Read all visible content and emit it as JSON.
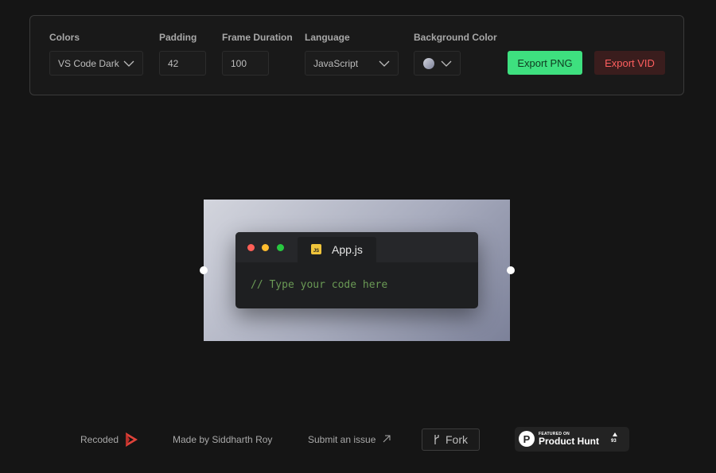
{
  "toolbar": {
    "colors": {
      "label": "Colors",
      "value": "VS Code Dark"
    },
    "padding": {
      "label": "Padding",
      "value": "42"
    },
    "frame_duration": {
      "label": "Frame Duration",
      "value": "100"
    },
    "language": {
      "label": "Language",
      "value": "JavaScript"
    },
    "background_color": {
      "label": "Background Color",
      "swatch_color": "#a7abbd"
    },
    "export_png_label": "Export PNG",
    "export_vid_label": "Export VID"
  },
  "editor": {
    "window_controls": [
      "red",
      "yellow",
      "green"
    ],
    "file_tab": {
      "icon": "javascript-file-icon",
      "badge": "JS",
      "name": "App.js"
    },
    "code": "// Type your code here",
    "frame_gradient": [
      "#d3d5dd",
      "#a7abbd",
      "#7c8199"
    ]
  },
  "footer": {
    "recoded": "Recoded",
    "made_by": "Made by Siddharth Roy",
    "submit_issue": "Submit an issue",
    "fork": "Fork",
    "product_hunt": {
      "featured": "FEATURED ON",
      "name": "Product Hunt",
      "count": "93"
    }
  },
  "colors": {
    "background": "#151515",
    "accent_green": "#3ee07f",
    "accent_red": "#ff5f5f",
    "code_comment": "#6a9955"
  }
}
